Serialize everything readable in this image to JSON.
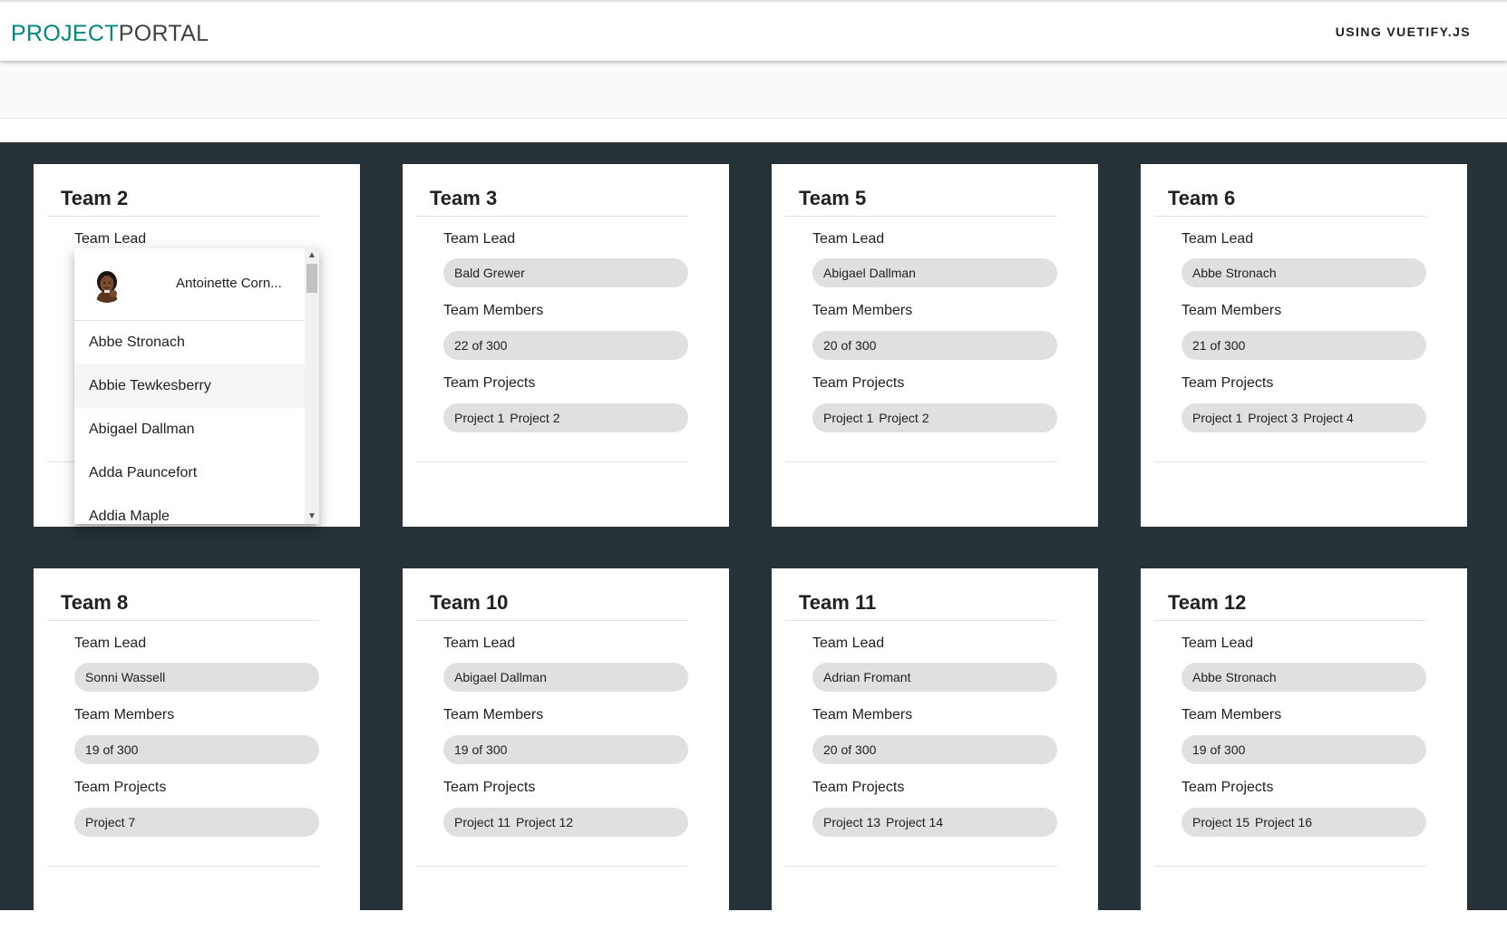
{
  "header": {
    "logo_part1": "PROJECT",
    "logo_part2": "PORTAL",
    "link": "USING VUETIFY.JS"
  },
  "labels": {
    "team_lead": "Team Lead",
    "team_members": "Team Members",
    "team_projects": "Team Projects"
  },
  "teams": [
    {
      "name": "Team 2",
      "lead": "",
      "members": "",
      "projects": []
    },
    {
      "name": "Team 3",
      "lead": "Bald Grewer",
      "members": "22 of 300",
      "projects": [
        "Project 1",
        "Project 2"
      ]
    },
    {
      "name": "Team 5",
      "lead": "Abigael Dallman",
      "members": "20 of 300",
      "projects": [
        "Project 1",
        "Project 2"
      ]
    },
    {
      "name": "Team 6",
      "lead": "Abbe Stronach",
      "members": "21 of 300",
      "projects": [
        "Project 1",
        "Project 3",
        "Project 4"
      ]
    },
    {
      "name": "Team 8",
      "lead": "Sonni Wassell",
      "members": "19 of 300",
      "projects": [
        "Project 7"
      ]
    },
    {
      "name": "Team 10",
      "lead": "Abigael Dallman",
      "members": "19 of 300",
      "projects": [
        "Project 11",
        "Project 12"
      ]
    },
    {
      "name": "Team 11",
      "lead": "Adrian Fromant",
      "members": "20 of 300",
      "projects": [
        "Project 13",
        "Project 14"
      ]
    },
    {
      "name": "Team 12",
      "lead": "Abbe Stronach",
      "members": "19 of 300",
      "projects": [
        "Project 15",
        "Project 16"
      ]
    }
  ],
  "dropdown": {
    "selected": "Antoinette Corn...",
    "items": [
      "Abbe Stronach",
      "Abbie Tewkesberry",
      "Abigael Dallman",
      "Adda Pauncefort",
      "Addia Maple"
    ],
    "hover_index": 1
  }
}
